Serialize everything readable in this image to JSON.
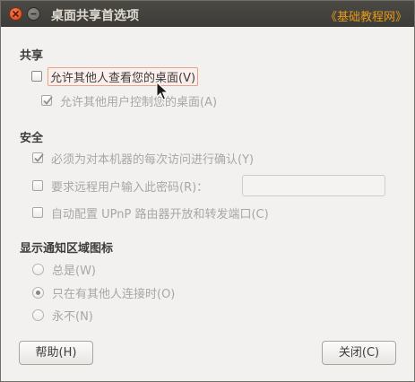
{
  "window": {
    "title": "桌面共享首选项",
    "watermark": "《基础教程网》",
    "close_icon": "close-icon",
    "minimize_icon": "minimize-icon"
  },
  "sharing": {
    "heading": "共享",
    "allow_view": {
      "label": "允许其他人查看您的桌面(V)",
      "checked": false
    },
    "allow_control": {
      "label": "允许其他用户控制您的桌面(A)",
      "checked": true,
      "enabled": false
    }
  },
  "security": {
    "heading": "安全",
    "confirm_each": {
      "label": "必须为对本机器的每次访问进行确认(Y)",
      "checked": true,
      "enabled": false
    },
    "require_password": {
      "label": "要求远程用户输入此密码(R)：",
      "checked": false,
      "enabled": false,
      "value": ""
    },
    "upnp": {
      "label": "自动配置 UPnP 路由器开放和转发端口(C)",
      "checked": false,
      "enabled": false
    }
  },
  "notification": {
    "heading": "显示通知区域图标",
    "options": [
      {
        "label": "总是(W)",
        "selected": false
      },
      {
        "label": "只在有其他人连接时(O)",
        "selected": true
      },
      {
        "label": "永不(N)",
        "selected": false
      }
    ]
  },
  "buttons": {
    "help": "帮助(H)",
    "close": "关闭(C)"
  },
  "colors": {
    "titlebar": "#3c3b37",
    "close_button": "#e25a2d",
    "watermark": "#e89a17",
    "focus_border": "#e7a38d"
  }
}
